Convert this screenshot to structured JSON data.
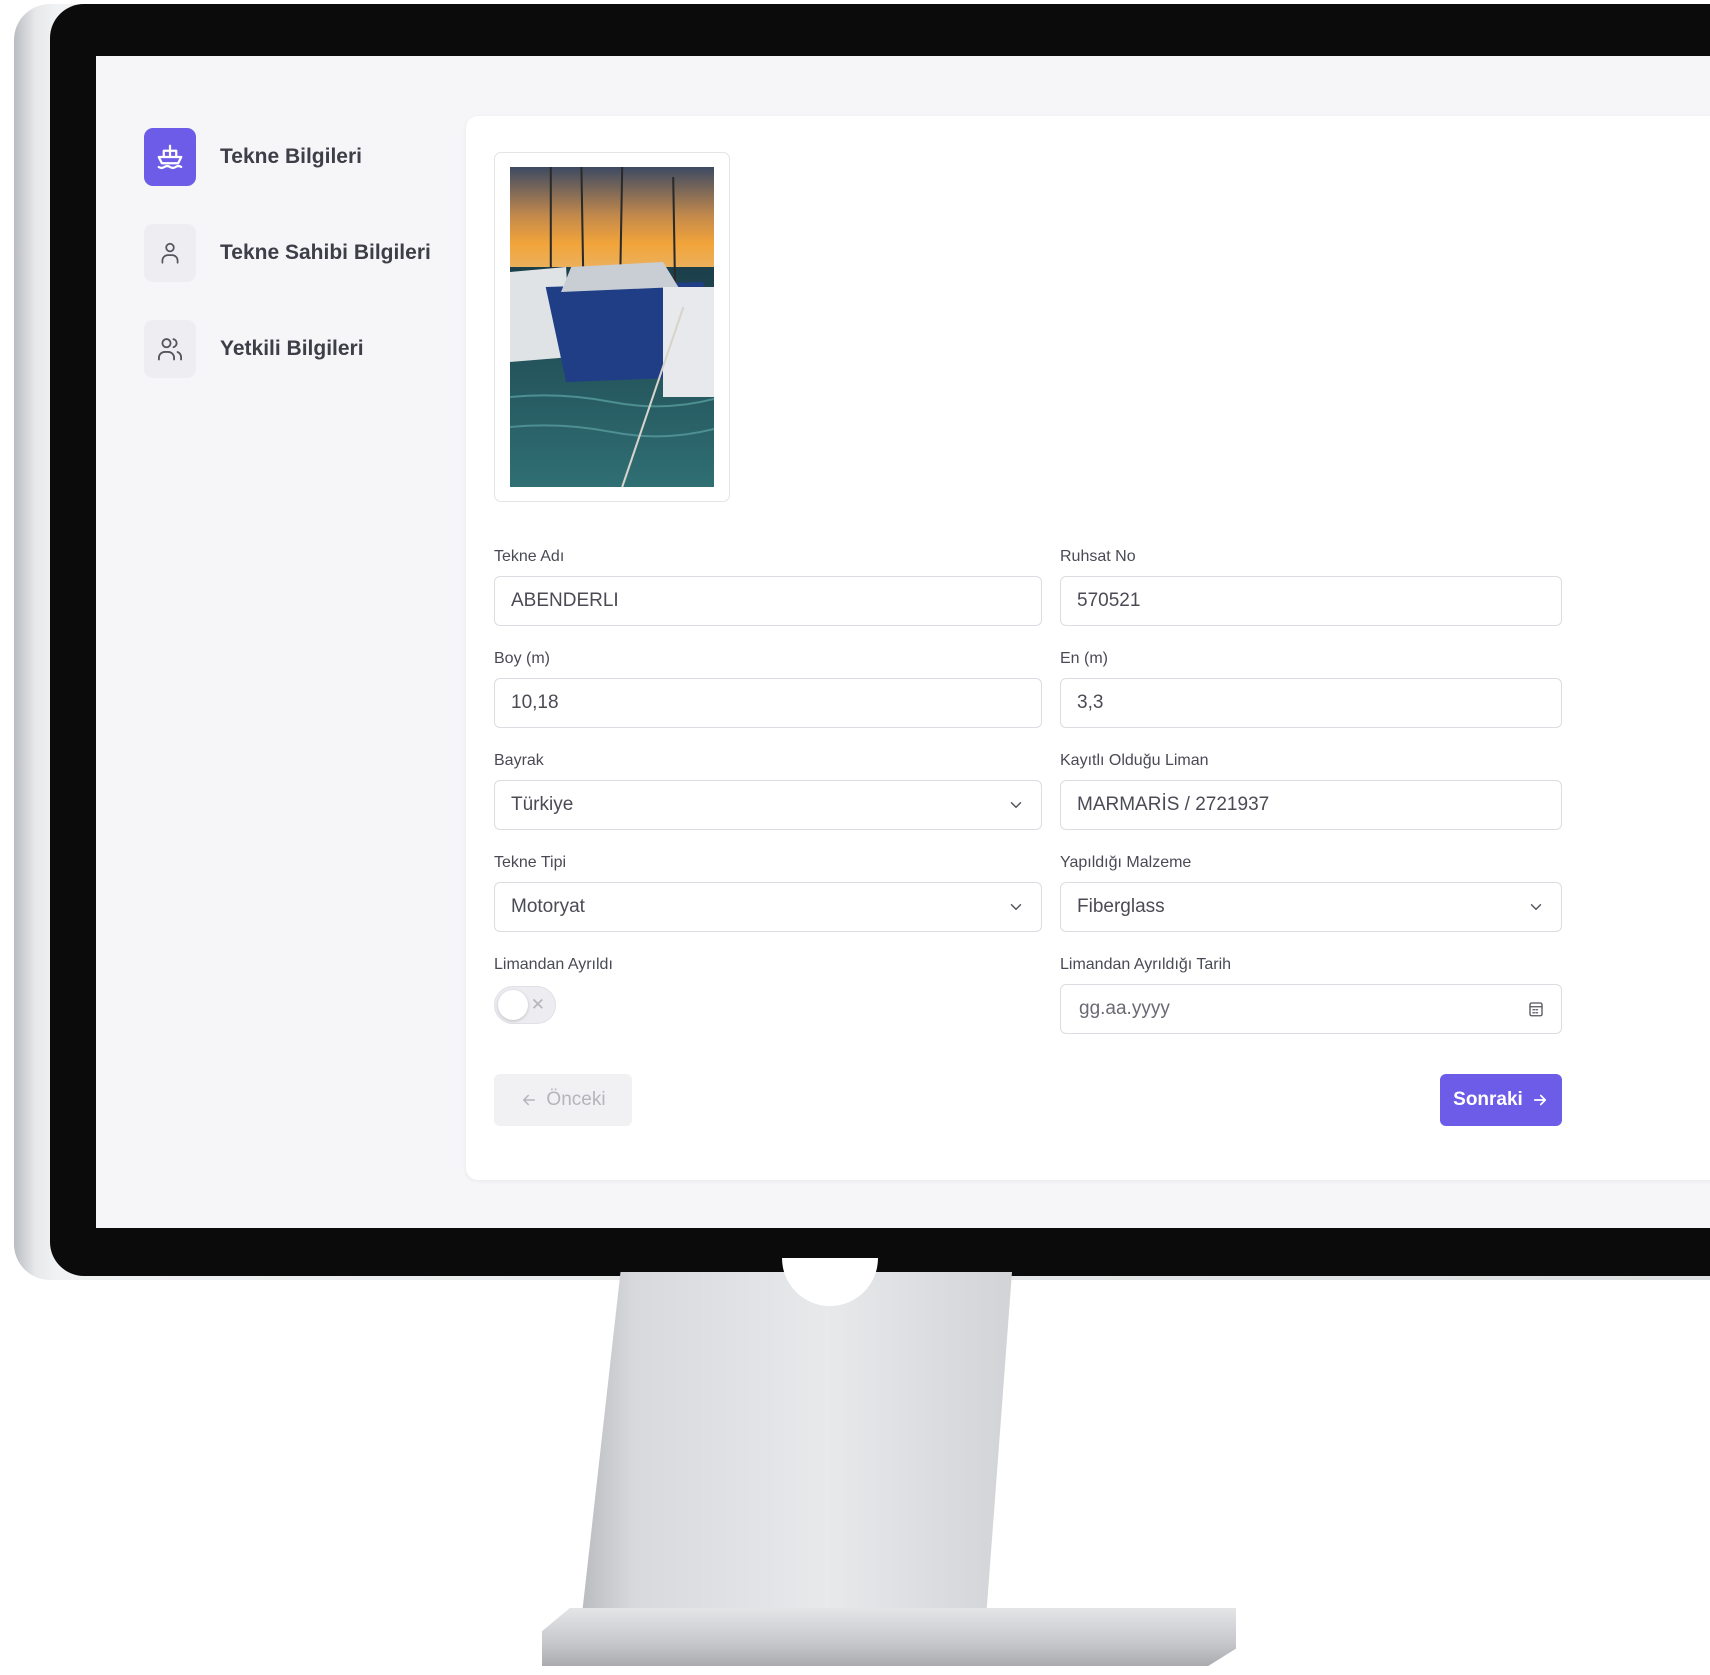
{
  "sidebar": {
    "steps": [
      {
        "label": "Tekne Bilgileri",
        "icon": "boat-icon",
        "active": true
      },
      {
        "label": "Tekne Sahibi Bilgileri",
        "icon": "user-icon",
        "active": false
      },
      {
        "label": "Yetkili Bilgileri",
        "icon": "users-icon",
        "active": false
      }
    ]
  },
  "form": {
    "boat_name": {
      "label": "Tekne Adı",
      "value": "ABENDERLI"
    },
    "license_no": {
      "label": "Ruhsat No",
      "value": "570521"
    },
    "length": {
      "label": "Boy (m)",
      "value": "10,18"
    },
    "width": {
      "label": "En (m)",
      "value": "3,3"
    },
    "flag": {
      "label": "Bayrak",
      "value": "Türkiye"
    },
    "port": {
      "label": "Kayıtlı Olduğu Liman",
      "value": "MARMARİS / 2721937"
    },
    "boat_type": {
      "label": "Tekne Tipi",
      "value": "Motoryat"
    },
    "material": {
      "label": "Yapıldığı Malzeme",
      "value": "Fiberglass"
    },
    "left_port": {
      "label": "Limandan Ayrıldı",
      "on": false
    },
    "left_port_date": {
      "label": "Limandan Ayrıldığı Tarih",
      "placeholder": "gg.aa.yyyy"
    }
  },
  "buttons": {
    "prev": "Önceki",
    "next": "Sonraki"
  },
  "colors": {
    "accent": "#6c5ce7",
    "screen_bg": "#f6f6f9",
    "card_bg": "#ffffff"
  }
}
